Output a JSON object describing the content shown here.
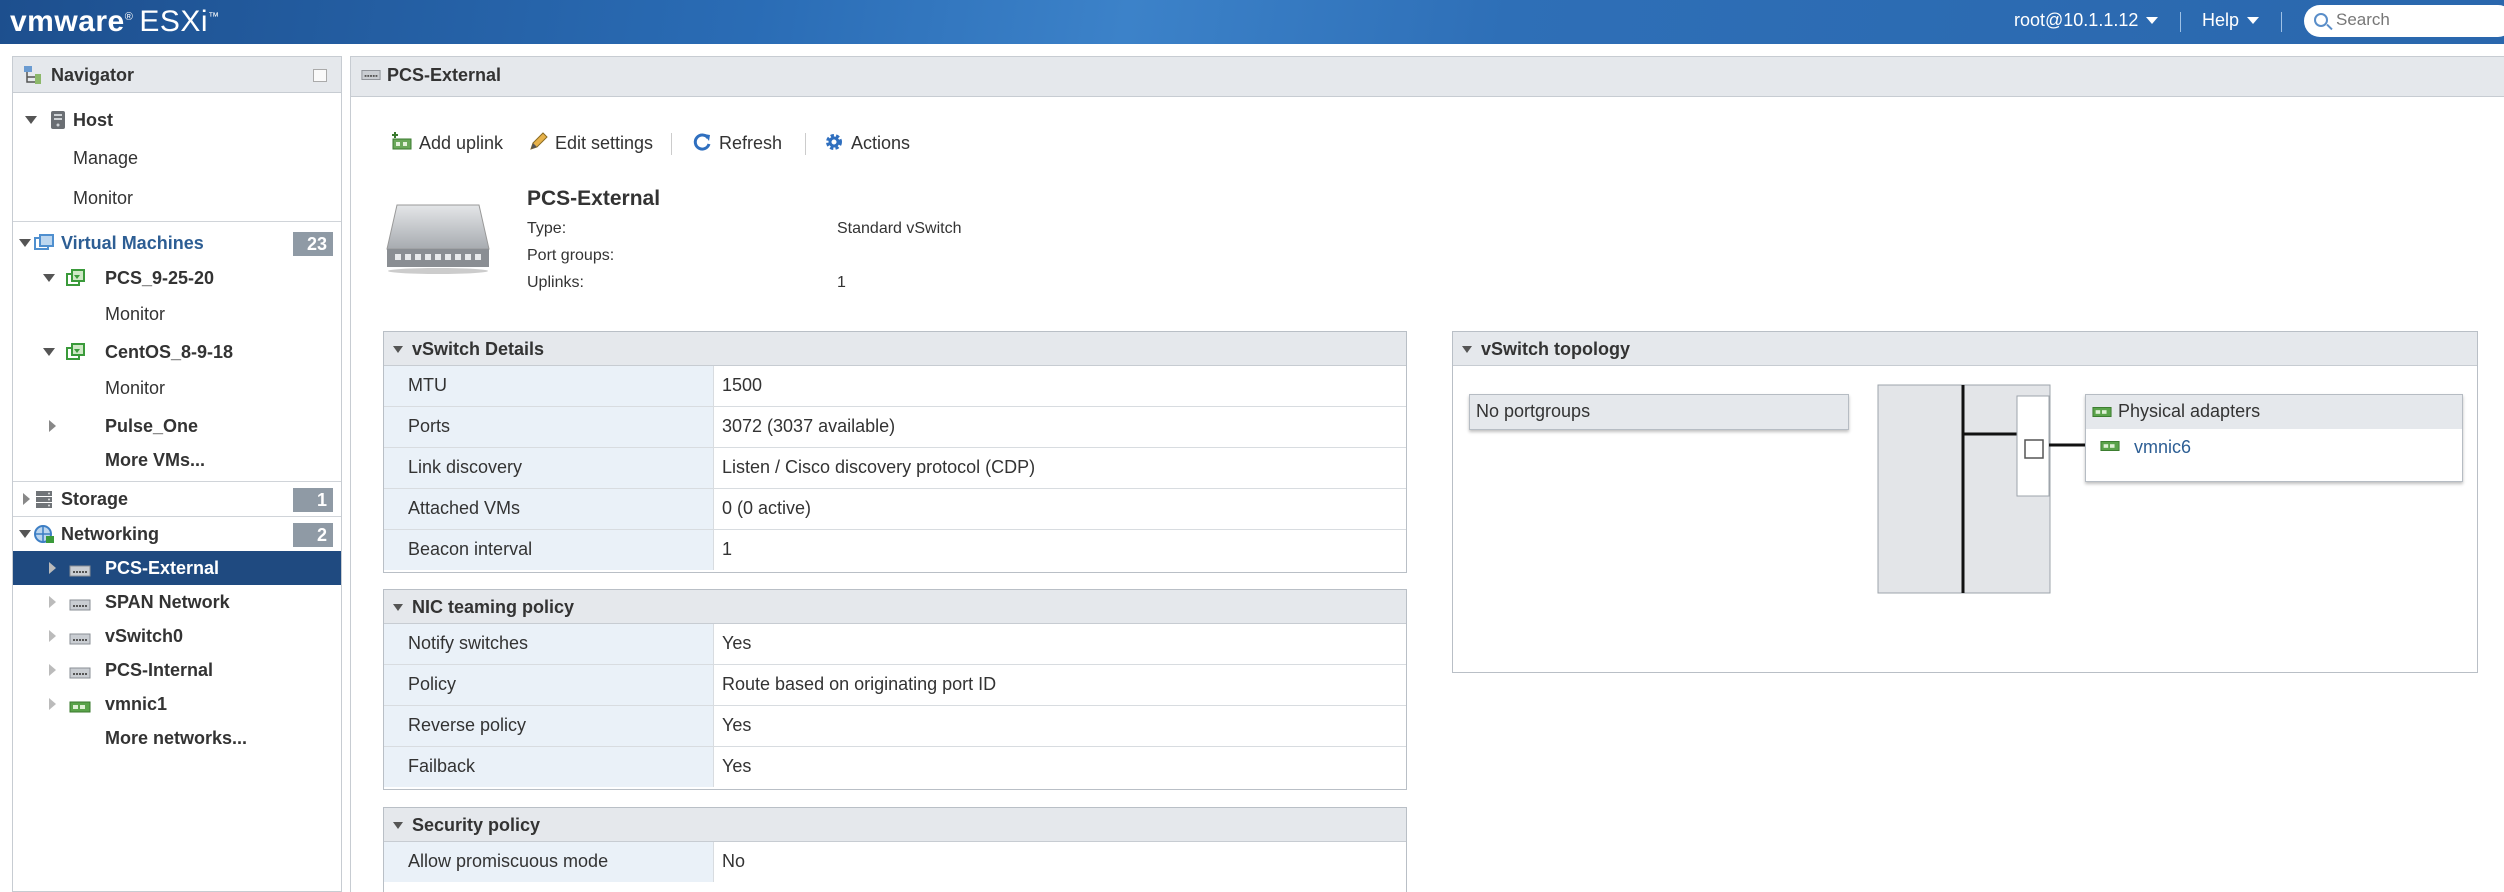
{
  "topbar": {
    "brand_vm": "vmware",
    "brand_product": "ESXi",
    "user": "root@10.1.1.12",
    "help": "Help",
    "search_placeholder": "Search"
  },
  "navigator": {
    "title": "Navigator",
    "host": {
      "label": "Host",
      "children": [
        "Manage",
        "Monitor"
      ]
    },
    "vms": {
      "label": "Virtual Machines",
      "count": "23",
      "items": [
        {
          "label": "PCS_9-25-20",
          "child": "Monitor"
        },
        {
          "label": "CentOS_8-9-18",
          "child": "Monitor"
        },
        {
          "label": "Pulse_One"
        }
      ],
      "more": "More VMs..."
    },
    "storage": {
      "label": "Storage",
      "count": "1"
    },
    "networking": {
      "label": "Networking",
      "count": "2",
      "items": [
        "PCS-External",
        "SPAN Network",
        "vSwitch0",
        "PCS-Internal",
        "vmnic1"
      ],
      "more": "More networks..."
    }
  },
  "main": {
    "title": "PCS-External",
    "toolbar": {
      "add_uplink": "Add uplink",
      "edit_settings": "Edit settings",
      "refresh": "Refresh",
      "actions": "Actions"
    },
    "summary": {
      "name": "PCS-External",
      "type_label": "Type:",
      "type_value": "Standard vSwitch",
      "portgroups_label": "Port groups:",
      "portgroups_value": "",
      "uplinks_label": "Uplinks:",
      "uplinks_value": "1"
    },
    "vswitch_details": {
      "title": "vSwitch Details",
      "rows": [
        {
          "k": "MTU",
          "v": "1500"
        },
        {
          "k": "Ports",
          "v": "3072 (3037 available)"
        },
        {
          "k": "Link discovery",
          "v": "Listen / Cisco discovery protocol (CDP)"
        },
        {
          "k": "Attached VMs",
          "v": "0 (0 active)"
        },
        {
          "k": "Beacon interval",
          "v": "1"
        }
      ]
    },
    "nic_teaming": {
      "title": "NIC teaming policy",
      "rows": [
        {
          "k": "Notify switches",
          "v": "Yes"
        },
        {
          "k": "Policy",
          "v": "Route based on originating port ID"
        },
        {
          "k": "Reverse policy",
          "v": "Yes"
        },
        {
          "k": "Failback",
          "v": "Yes"
        }
      ]
    },
    "security": {
      "title": "Security policy",
      "rows": [
        {
          "k": "Allow promiscuous mode",
          "v": "No"
        }
      ]
    },
    "topology": {
      "title": "vSwitch topology",
      "portgroups": "No portgroups",
      "adapters_title": "Physical adapters",
      "adapter": "vmnic6"
    }
  }
}
